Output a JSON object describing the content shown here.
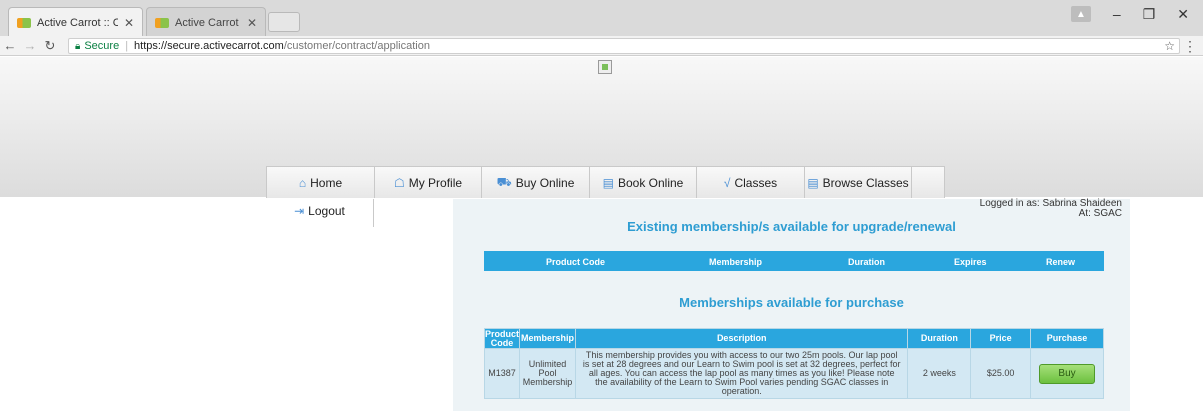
{
  "browser": {
    "tabs": [
      {
        "title": "Active Carrot :: Custome",
        "active": true
      },
      {
        "title": "Active Carrot :: Manager",
        "active": false
      }
    ],
    "tab_close": "✕",
    "secure_label": "Secure",
    "url_host": "https://secure.activecarrot.com",
    "url_path": "/customer/contract/application"
  },
  "nav": {
    "items": [
      {
        "label": "Home",
        "icon": "home-icon"
      },
      {
        "label": "My Profile",
        "icon": "profile-icon"
      },
      {
        "label": "Buy Online",
        "icon": "cart-icon"
      },
      {
        "label": "Book Online",
        "icon": "book-icon"
      },
      {
        "label": "Classes",
        "icon": "classes-icon"
      },
      {
        "label": "Browse Classes",
        "icon": "browse-icon"
      }
    ],
    "logout": "Logout"
  },
  "user": {
    "logged_in": "Logged in as: Sabrina Shaideen",
    "location": "At: SGAC"
  },
  "existing": {
    "heading": "Existing membership/s available for upgrade/renewal",
    "columns": [
      "Product Code",
      "Membership",
      "Duration",
      "Expires",
      "Renew"
    ]
  },
  "purchase": {
    "heading": "Memberships available for purchase",
    "columns": [
      "Product Code",
      "Membership",
      "Description",
      "Duration",
      "Price",
      "Purchase"
    ],
    "rows": [
      {
        "code": "M1387",
        "membership": "Unlimited Pool Membership",
        "description": "This membership provides you with access to our two 25m pools. Our lap pool is set at 28 degrees and our Learn to Swim pool is set at 32 degrees, perfect for all ages. You can access the lap pool as many times as you like! Please note the availability of the Learn to Swim Pool varies pending SGAC classes in operation.",
        "duration": "2 weeks",
        "price": "$25.00",
        "action": "Buy"
      }
    ]
  },
  "colors": {
    "accent": "#2aa6de",
    "heading": "#2e9dd2",
    "buy_button": "#6cc03f"
  }
}
